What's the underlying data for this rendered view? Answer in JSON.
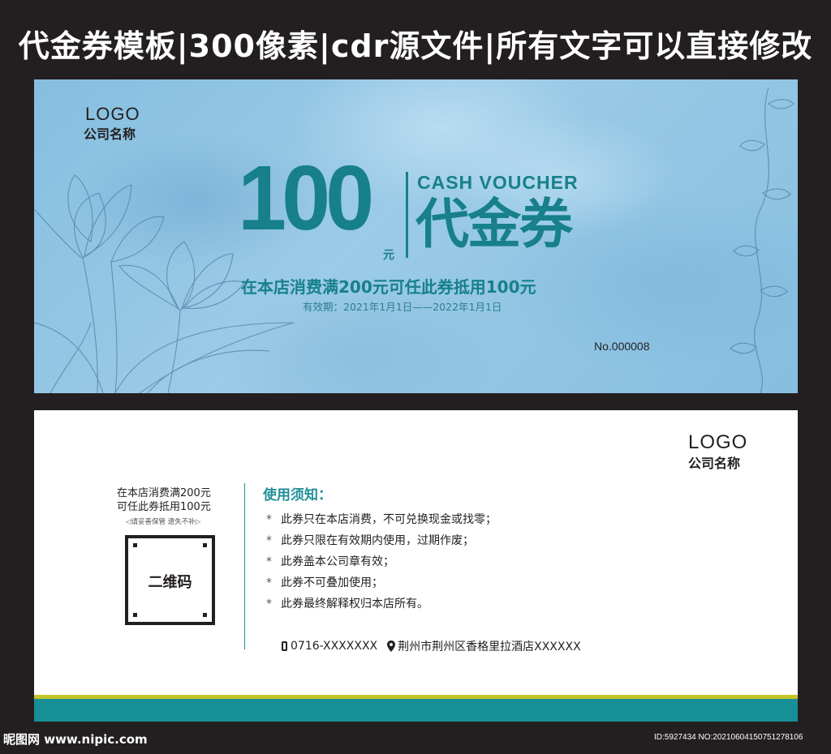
{
  "banner": {
    "title": "代金券模板|300像素|cdr源文件|所有文字可以直接修改"
  },
  "front": {
    "logo": "LOGO",
    "company": "公司名称",
    "amount": "100",
    "unit": "元",
    "cash_voucher": "CASH VOUCHER",
    "voucher_big": "代金券",
    "condition": "在本店消费满200元可任此券抵用100元",
    "validity": "有效期：2021年1月1日——2022年1月1日",
    "serial": "No.000008"
  },
  "back": {
    "logo": "LOGO",
    "company": "公司名称",
    "condition_line1": "在本店消费满200元",
    "condition_line2": "可任此券抵用100元",
    "keep_note": "◁请妥善保管  遗失不补▷",
    "qr_label": "二维码",
    "notice_title": "使用须知：",
    "notices": [
      "此券只在本店消费，不可兑换现金或找零；",
      "此券只限在有效期内使用，过期作废；",
      "此券盖本公司章有效；",
      "此券不可叠加使用；",
      "此券最终解释权归本店所有。"
    ],
    "bullet": "*",
    "phone": "0716-XXXXXXX",
    "address": "荆州市荆州区香格里拉酒店XXXXXX"
  },
  "footer": {
    "site": "昵图网 www.nipic.com",
    "id_text": "ID:5927434 NO:20210604150751278106"
  },
  "colors": {
    "background": "#231f20",
    "front_blue": "#8fc3e2",
    "teal": "#17808a",
    "stripe_yellow": "#c7c42a",
    "stripe_teal": "#168f96"
  },
  "icons": {
    "phone": "phone-icon",
    "location": "location-pin-icon"
  }
}
